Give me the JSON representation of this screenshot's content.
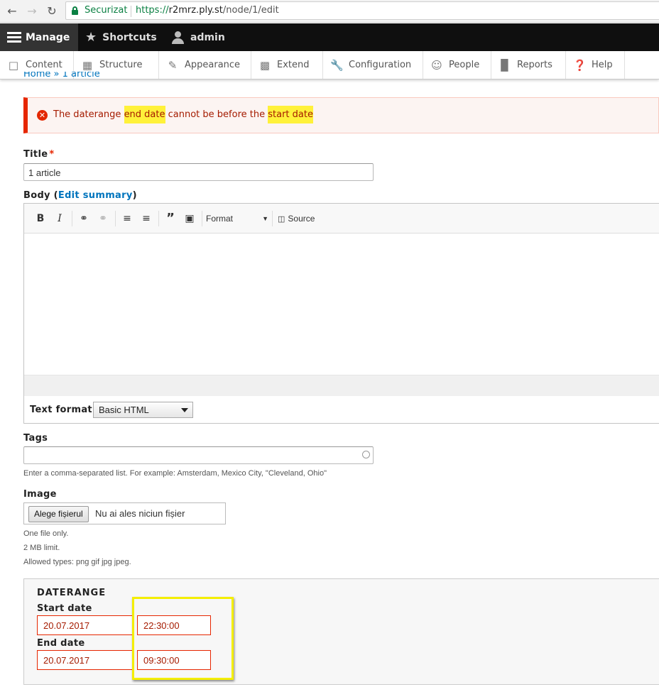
{
  "browser": {
    "secure_label": "Securizat",
    "url_scheme": "https://",
    "url_host": "r2mrz.ply.st",
    "url_path": "/node/1/edit"
  },
  "toolbar": {
    "manage": "Manage",
    "shortcuts": "Shortcuts",
    "user": "admin"
  },
  "tray": {
    "items": [
      "Content",
      "Structure",
      "Appearance",
      "Extend",
      "Configuration",
      "People",
      "Reports",
      "Help"
    ]
  },
  "breadcrumb": "Home » 1 article",
  "error": {
    "prefix": "The daterange ",
    "end": "end date",
    "middle": " cannot be before the ",
    "start": "start date"
  },
  "title": {
    "label": "Title",
    "required_mark": "*",
    "value": "1 article"
  },
  "body": {
    "label": "Body (",
    "link": "Edit summary",
    "label_end": ")",
    "format_label": "Format",
    "source_label": "Source"
  },
  "text_format": {
    "label": "Text format",
    "selected": "Basic HTML"
  },
  "tags": {
    "label": "Tags",
    "description": "Enter a comma-separated list. For example: Amsterdam, Mexico City, \"Cleveland, Ohio\""
  },
  "image": {
    "label": "Image",
    "choose_button": "Alege fișierul",
    "status": "Nu ai ales niciun fișier",
    "desc1": "One file only.",
    "desc2": "2 MB limit.",
    "desc3": "Allowed types: png gif jpg jpeg."
  },
  "daterange": {
    "legend": "DATERANGE",
    "start_label": "Start date",
    "start_date": "20.07.2017",
    "start_time": "22:30:00",
    "end_label": "End date",
    "end_date": "20.07.2017",
    "end_time": "09:30:00"
  },
  "colors": {
    "error_red": "#e62600",
    "highlight_yellow": "#fff13a",
    "link_blue": "#0074bd"
  }
}
